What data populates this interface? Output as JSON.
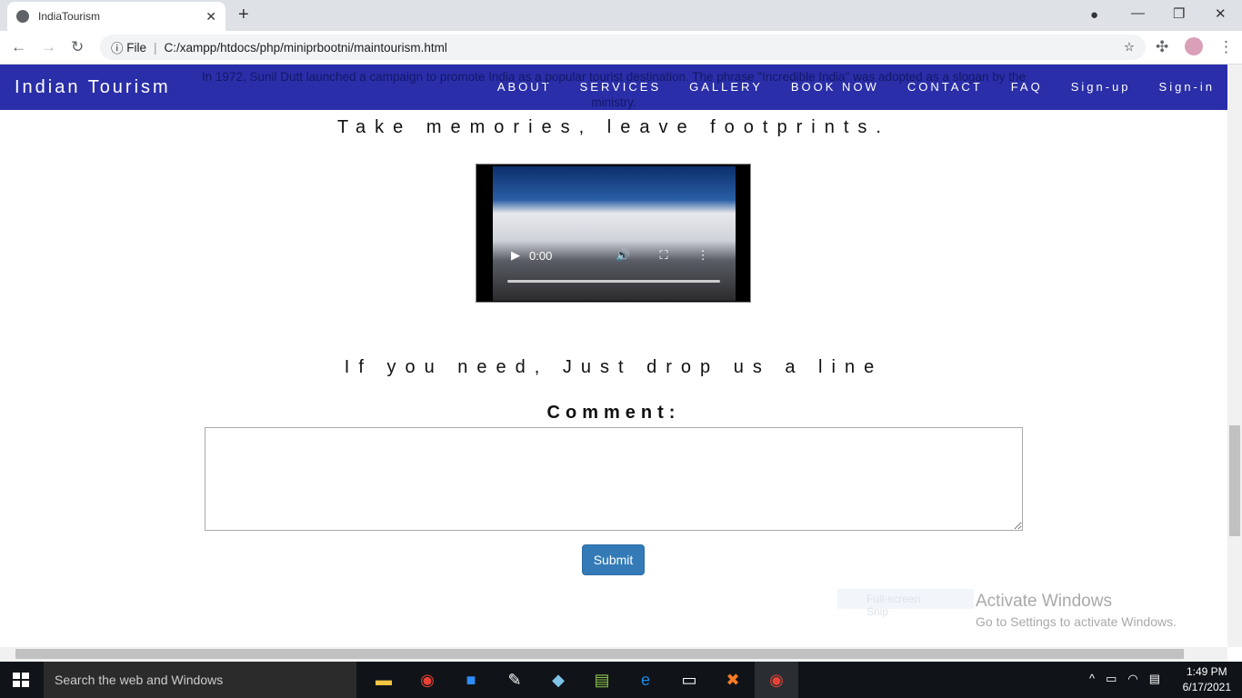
{
  "browser": {
    "tab_title": "IndiaTourism",
    "url_scheme": "File",
    "url": "C:/xampp/htdocs/php/miniprbootni/maintourism.html"
  },
  "navbar": {
    "brand": "Indian Tourism",
    "items": [
      "ABOUT",
      "SERVICES",
      "GALLERY",
      "BOOK NOW",
      "CONTACT",
      "FAQ",
      "Sign-up",
      "Sign-in"
    ]
  },
  "background_text": "In 1972, Sunil Dutt launched a campaign to promote India as a popular tourist destination. The phrase \"Incredible India\" was adopted as a slogan by the ministry.",
  "tagline": "Take memories, leave footprints.",
  "video": {
    "time": "0:00",
    "progress": 0
  },
  "contact": {
    "heading": "If you need, Just drop us a line",
    "comment_label": "Comment:",
    "comment_value": "",
    "submit": "Submit"
  },
  "overlay": {
    "snip": "Full-screen Snip",
    "activate_title": "Activate Windows",
    "activate_sub": "Go to Settings to activate Windows."
  },
  "taskbar": {
    "search_placeholder": "Search the web and Windows",
    "time": "1:49 PM",
    "date": "6/17/2021"
  }
}
